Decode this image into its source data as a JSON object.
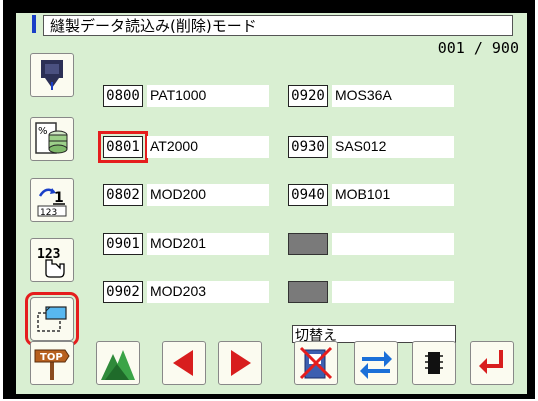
{
  "title": "縫製データ読込み(削除)モード",
  "page_indicator": "001 / 900",
  "patterns": [
    {
      "code": "0800",
      "name": "PAT1000"
    },
    {
      "code": "0920",
      "name": "MOS36A"
    },
    {
      "code": "0801",
      "name": "AT2000"
    },
    {
      "code": "0930",
      "name": "SAS012"
    },
    {
      "code": "0802",
      "name": "MOD200"
    },
    {
      "code": "0940",
      "name": "MOB101"
    },
    {
      "code": "0901",
      "name": "MOD201"
    },
    {
      "code": "",
      "name": ""
    },
    {
      "code": "0902",
      "name": "MOD203"
    },
    {
      "code": "",
      "name": ""
    }
  ],
  "toggle_label": "切替え",
  "icons": {
    "side": [
      "needle-icon",
      "storage-percent-icon",
      "numbered-list-icon",
      "numeric-keypad-icon",
      "folder-icon"
    ],
    "bottom": [
      "top-sign-icon",
      "trees-icon",
      "left-arrow-icon",
      "right-arrow-icon",
      "crossed-out-icon",
      "swap-arrows-icon",
      "chip-icon",
      "enter-icon"
    ]
  },
  "colors": {
    "screen_bg": "#d9efd2",
    "highlight": "#e51d1d",
    "accent_blue": "#1a3fc7",
    "arrow_red": "#d81e1e"
  }
}
